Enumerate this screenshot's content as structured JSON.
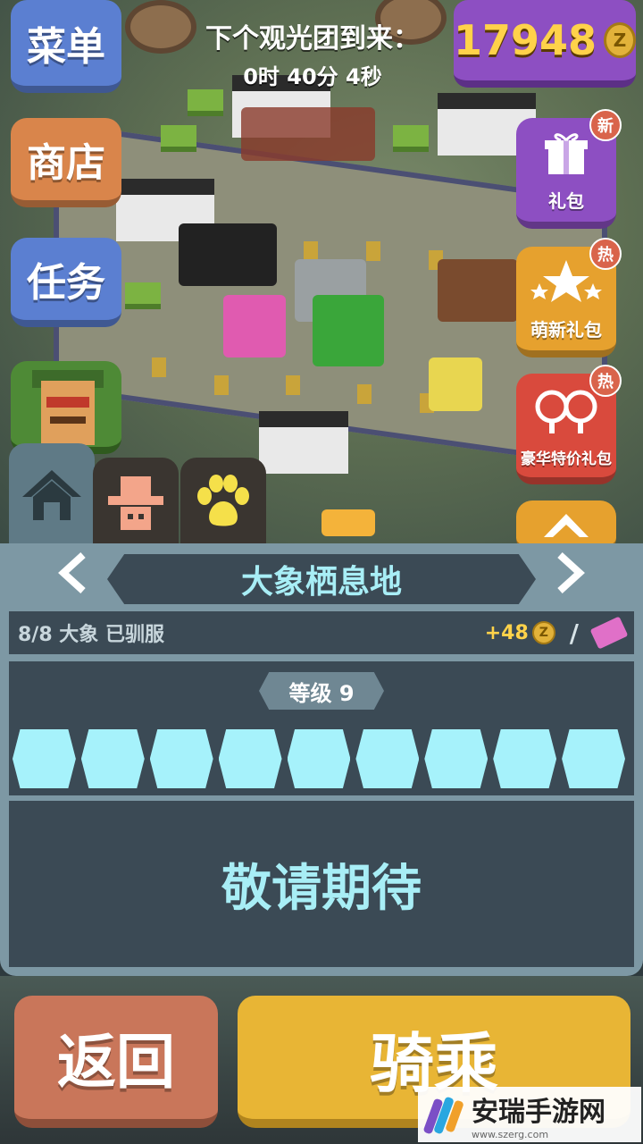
{
  "hud": {
    "menu_label": "菜单",
    "shop_label": "商店",
    "task_label": "任务",
    "timer_title": "下个观光团到来：",
    "timer_value": "0时 40分 4秒",
    "coins": "17948",
    "coin_symbol": "Z"
  },
  "promos": [
    {
      "label": "礼包",
      "badge": "新"
    },
    {
      "label": "萌新礼包",
      "badge": "热"
    },
    {
      "label": "豪华特价礼包",
      "badge": "热"
    }
  ],
  "tabs": [
    "home-icon",
    "cowboy-hat-icon",
    "paw-icon"
  ],
  "habitat": {
    "title": "大象栖息地",
    "tamed_text": "8/8 大象 已驯服",
    "reward": "+48",
    "level_label": "等级 9",
    "level_progress": 9,
    "level_max": 9,
    "status": "敬请期待"
  },
  "actions": {
    "back_label": "返回",
    "ride_label": "骑乘"
  },
  "watermark": {
    "name": "安瑞手游网",
    "url": "www.szerg.com"
  },
  "colors": {
    "accent_cyan": "#a8eef6",
    "coin_gold": "#ffd24a",
    "panel": "#7d98a4",
    "panel_dark": "#3b4a55"
  }
}
